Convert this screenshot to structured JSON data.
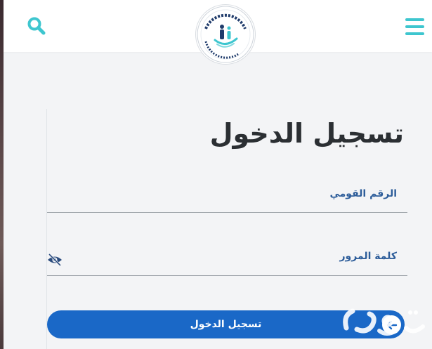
{
  "header": {
    "search_icon": "search-icon",
    "menu_icon": "hamburger-menu-icon",
    "logo_text": "الهيئة القومية للتأمين الاجتماعي National Organization for Social Insurance",
    "brand_color": "#3ec6cf"
  },
  "form": {
    "title": "تسجيل الدخول",
    "national_id_label": "الرقم القومي",
    "password_label": "كلمة المرور",
    "national_id_value": "",
    "password_value": "",
    "eye_icon": "eye-slash-icon",
    "login_button_label": "تسجيل الدخول",
    "arrow_icon": "arrow-left-icon",
    "button_color": "#1a68c7"
  }
}
